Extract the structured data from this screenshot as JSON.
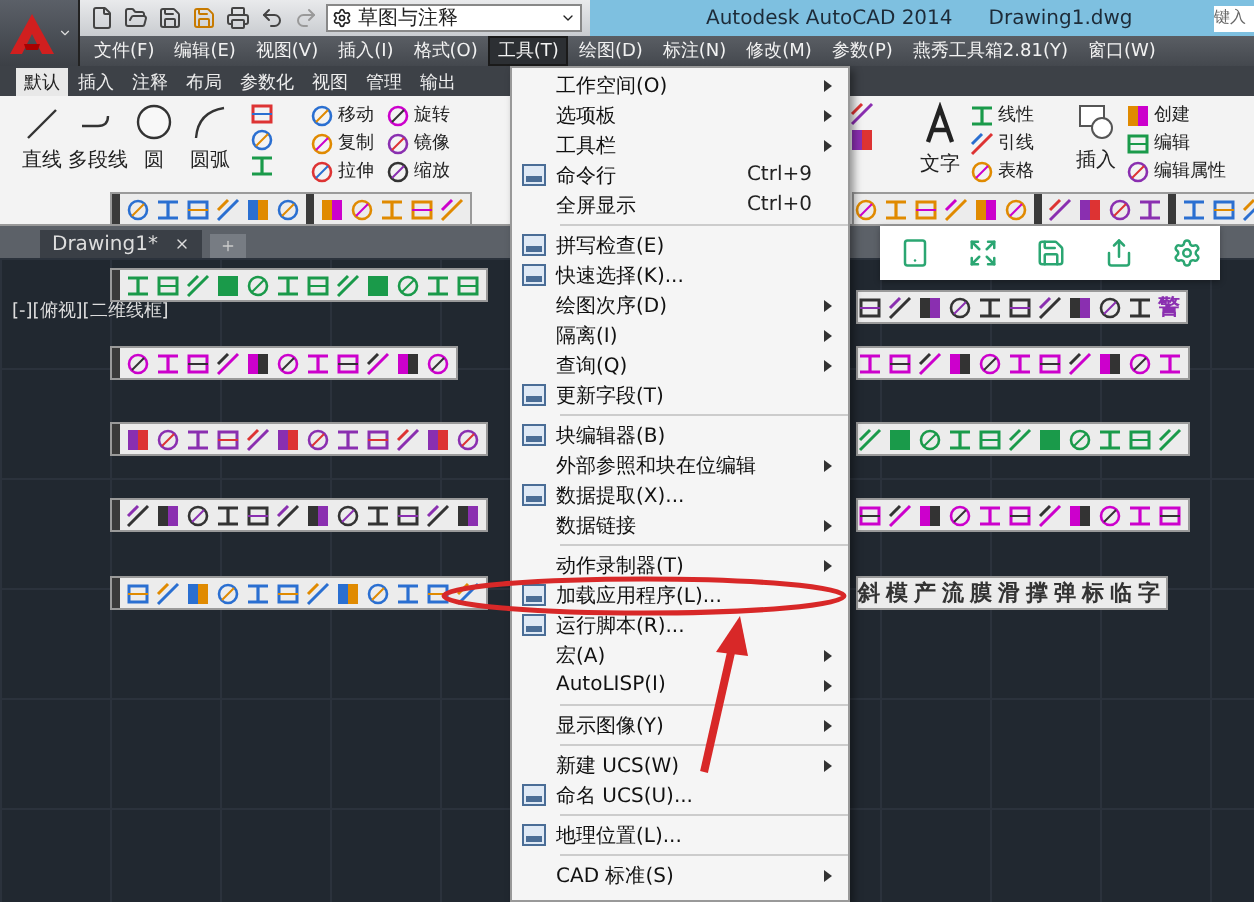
{
  "app": {
    "title": "Autodesk AutoCAD 2014",
    "document": "Drawing1.dwg",
    "search_placeholder": "键入"
  },
  "workspace": {
    "value": "草图与注释"
  },
  "menu_bar": [
    {
      "label": "文件(F)",
      "selected": false
    },
    {
      "label": "编辑(E)",
      "selected": false
    },
    {
      "label": "视图(V)",
      "selected": false
    },
    {
      "label": "插入(I)",
      "selected": false
    },
    {
      "label": "格式(O)",
      "selected": false
    },
    {
      "label": "工具(T)",
      "selected": true
    },
    {
      "label": "绘图(D)",
      "selected": false
    },
    {
      "label": "标注(N)",
      "selected": false
    },
    {
      "label": "修改(M)",
      "selected": false
    },
    {
      "label": "参数(P)",
      "selected": false
    },
    {
      "label": "燕秀工具箱2.81(Y)",
      "selected": false
    },
    {
      "label": "窗口(W)",
      "selected": false
    }
  ],
  "ribbon": {
    "tabs": [
      {
        "label": "默认",
        "selected": true
      },
      {
        "label": "插入",
        "selected": false
      },
      {
        "label": "注释",
        "selected": false
      },
      {
        "label": "布局",
        "selected": false
      },
      {
        "label": "参数化",
        "selected": false
      },
      {
        "label": "视图",
        "selected": false
      },
      {
        "label": "管理",
        "selected": false
      },
      {
        "label": "输出",
        "selected": false
      }
    ],
    "draw_tools": [
      "直线",
      "多段线",
      "圆",
      "圆弧"
    ],
    "modify_tools": [
      "移动",
      "旋转",
      "复制",
      "镜像",
      "拉伸",
      "缩放"
    ],
    "text_tool": "文字",
    "annotation_tools": [
      "线性",
      "引线",
      "表格"
    ],
    "insert_tool": "插入",
    "block_tools": [
      "创建",
      "编辑",
      "编辑属性"
    ]
  },
  "file_tabs": [
    {
      "label": "Drawing1*",
      "selected": true
    }
  ],
  "viewport_label": "[-][俯视][二维线框]",
  "alert_button": "警",
  "text_buttons": [
    "斜",
    "模",
    "产",
    "流",
    "膜",
    "滑",
    "撑",
    "弹",
    "标",
    "临",
    "字"
  ],
  "tools_menu": [
    {
      "kind": "item",
      "label": "工作空间(O)",
      "submenu": true,
      "icon": false
    },
    {
      "kind": "item",
      "label": "选项板",
      "submenu": true,
      "icon": false
    },
    {
      "kind": "item",
      "label": "工具栏",
      "submenu": true,
      "icon": false
    },
    {
      "kind": "item",
      "label": "命令行",
      "shortcut": "Ctrl+9",
      "submenu": false,
      "icon": true
    },
    {
      "kind": "item",
      "label": "全屏显示",
      "shortcut": "Ctrl+0",
      "submenu": false,
      "icon": false
    },
    {
      "kind": "separator"
    },
    {
      "kind": "item",
      "label": "拼写检查(E)",
      "submenu": false,
      "icon": true
    },
    {
      "kind": "item",
      "label": "快速选择(K)...",
      "submenu": false,
      "icon": true
    },
    {
      "kind": "item",
      "label": "绘图次序(D)",
      "submenu": true,
      "icon": false
    },
    {
      "kind": "item",
      "label": "隔离(I)",
      "submenu": true,
      "icon": false
    },
    {
      "kind": "item",
      "label": "查询(Q)",
      "submenu": true,
      "icon": false
    },
    {
      "kind": "item",
      "label": "更新字段(T)",
      "submenu": false,
      "icon": true
    },
    {
      "kind": "separator"
    },
    {
      "kind": "item",
      "label": "块编辑器(B)",
      "submenu": false,
      "icon": true
    },
    {
      "kind": "item",
      "label": "外部参照和块在位编辑",
      "submenu": true,
      "icon": false
    },
    {
      "kind": "item",
      "label": "数据提取(X)...",
      "submenu": false,
      "icon": true
    },
    {
      "kind": "item",
      "label": "数据链接",
      "submenu": true,
      "icon": false
    },
    {
      "kind": "separator"
    },
    {
      "kind": "item",
      "label": "动作录制器(T)",
      "submenu": true,
      "icon": false
    },
    {
      "kind": "item",
      "label": "加载应用程序(L)...",
      "submenu": false,
      "icon": true
    },
    {
      "kind": "item",
      "label": "运行脚本(R)...",
      "submenu": false,
      "icon": true
    },
    {
      "kind": "item",
      "label": "宏(A)",
      "submenu": true,
      "icon": false
    },
    {
      "kind": "item",
      "label": "AutoLISP(I)",
      "submenu": true,
      "icon": false
    },
    {
      "kind": "separator"
    },
    {
      "kind": "item",
      "label": "显示图像(Y)",
      "submenu": true,
      "icon": false
    },
    {
      "kind": "separator"
    },
    {
      "kind": "item",
      "label": "新建 UCS(W)",
      "submenu": true,
      "icon": false
    },
    {
      "kind": "item",
      "label": "命名 UCS(U)...",
      "submenu": false,
      "icon": true
    },
    {
      "kind": "separator"
    },
    {
      "kind": "item",
      "label": "地理位置(L)...",
      "submenu": false,
      "icon": true
    },
    {
      "kind": "separator"
    },
    {
      "kind": "item",
      "label": "CAD 标准(S)",
      "submenu": true,
      "icon": false
    }
  ]
}
